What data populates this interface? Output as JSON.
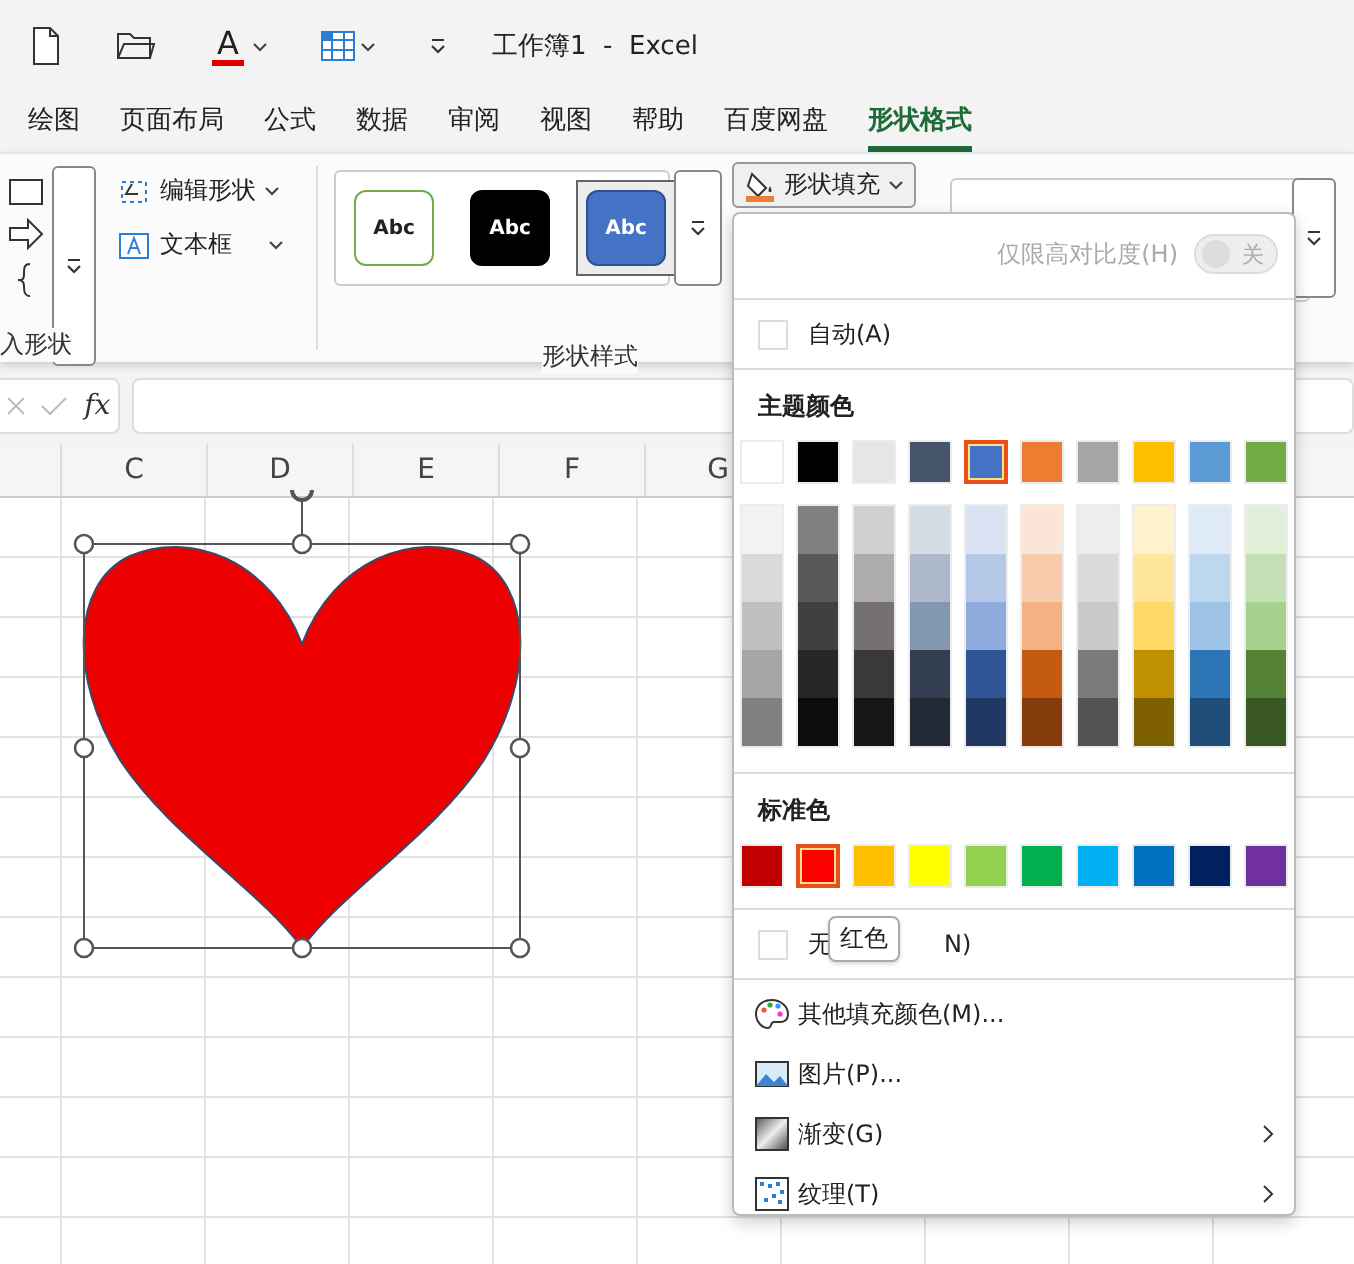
{
  "title_bar": {
    "font_color_glyph": "A",
    "title": "工作簿1  -  Excel"
  },
  "tabs": [
    {
      "label": "绘图",
      "selected": false
    },
    {
      "label": "页面布局",
      "selected": false
    },
    {
      "label": "公式",
      "selected": false
    },
    {
      "label": "数据",
      "selected": false
    },
    {
      "label": "审阅",
      "selected": false
    },
    {
      "label": "视图",
      "selected": false
    },
    {
      "label": "帮助",
      "selected": false
    },
    {
      "label": "百度网盘",
      "selected": false
    },
    {
      "label": "形状格式",
      "selected": true
    }
  ],
  "ribbon": {
    "insert_shapes_label": "入形状",
    "edit_shape": "编辑形状",
    "text_box": "文本框",
    "styles": [
      {
        "label": "Abc",
        "kind": "outline",
        "selected": false
      },
      {
        "label": "Abc",
        "kind": "dark",
        "selected": false
      },
      {
        "label": "Abc",
        "kind": "blue",
        "selected": true
      }
    ],
    "styles_label": "形状样式",
    "fill_button": "形状填充"
  },
  "formula_bar": {
    "fx": "fx"
  },
  "columns": [
    "C",
    "D",
    "E",
    "F",
    "G"
  ],
  "shape": {
    "selected": true
  },
  "fill_menu": {
    "high_contrast": {
      "label": "仅限高对比度(H)",
      "state_label": "关",
      "on": false
    },
    "auto": {
      "label": "自动(A)",
      "checked": false
    },
    "theme_title": "主题颜色",
    "theme_colors": [
      {
        "color": "#ffffff",
        "selected": false,
        "shades": [
          {
            "color": "#f2f2f2"
          },
          {
            "color": "#d9d9d9"
          },
          {
            "color": "#bfbfbf"
          },
          {
            "color": "#a6a6a6"
          },
          {
            "color": "#808080"
          }
        ]
      },
      {
        "color": "#000000",
        "selected": false,
        "shades": [
          {
            "color": "#808080"
          },
          {
            "color": "#595959"
          },
          {
            "color": "#404040"
          },
          {
            "color": "#262626"
          },
          {
            "color": "#0d0d0d"
          }
        ]
      },
      {
        "color": "#e7e6e6",
        "selected": false,
        "shades": [
          {
            "color": "#d0cece"
          },
          {
            "color": "#aeabab"
          },
          {
            "color": "#757171"
          },
          {
            "color": "#3a3838"
          },
          {
            "color": "#171616"
          }
        ]
      },
      {
        "color": "#44546a",
        "selected": false,
        "shades": [
          {
            "color": "#d6dce5"
          },
          {
            "color": "#adb9ca"
          },
          {
            "color": "#8497b0"
          },
          {
            "color": "#333f50"
          },
          {
            "color": "#222a35"
          }
        ]
      },
      {
        "color": "#4472c4",
        "selected": true,
        "shades": [
          {
            "color": "#dae3f3"
          },
          {
            "color": "#b4c7e7"
          },
          {
            "color": "#8faadc"
          },
          {
            "color": "#2f5597"
          },
          {
            "color": "#203864"
          }
        ]
      },
      {
        "color": "#ed7d31",
        "selected": false,
        "shades": [
          {
            "color": "#fbe5d6"
          },
          {
            "color": "#f8cbad"
          },
          {
            "color": "#f4b183"
          },
          {
            "color": "#c55a11"
          },
          {
            "color": "#843c0c"
          }
        ]
      },
      {
        "color": "#a5a5a5",
        "selected": false,
        "shades": [
          {
            "color": "#ededed"
          },
          {
            "color": "#dbdbdb"
          },
          {
            "color": "#c9c9c9"
          },
          {
            "color": "#7b7b7b"
          },
          {
            "color": "#525252"
          }
        ]
      },
      {
        "color": "#ffc000",
        "selected": false,
        "shades": [
          {
            "color": "#fff2cc"
          },
          {
            "color": "#ffe699"
          },
          {
            "color": "#ffd966"
          },
          {
            "color": "#bf9000"
          },
          {
            "color": "#7f6000"
          }
        ]
      },
      {
        "color": "#5b9bd5",
        "selected": false,
        "shades": [
          {
            "color": "#deebf7"
          },
          {
            "color": "#bdd7ee"
          },
          {
            "color": "#9dc3e6"
          },
          {
            "color": "#2e75b6"
          },
          {
            "color": "#1f4e79"
          }
        ]
      },
      {
        "color": "#70ad47",
        "selected": false,
        "shades": [
          {
            "color": "#e2f0d9"
          },
          {
            "color": "#c5e0b4"
          },
          {
            "color": "#a9d18e"
          },
          {
            "color": "#548235"
          },
          {
            "color": "#385723"
          }
        ]
      }
    ],
    "standard_title": "标准色",
    "standard_colors": [
      {
        "color": "#c00000",
        "selected": false
      },
      {
        "color": "#ff0000",
        "selected": true
      },
      {
        "color": "#ffc000",
        "selected": false
      },
      {
        "color": "#ffff00",
        "selected": false
      },
      {
        "color": "#92d050",
        "selected": false
      },
      {
        "color": "#00b050",
        "selected": false
      },
      {
        "color": "#00b0f0",
        "selected": false
      },
      {
        "color": "#0070c0",
        "selected": false
      },
      {
        "color": "#002060",
        "selected": false
      },
      {
        "color": "#7030a0",
        "selected": false
      }
    ],
    "no_fill": {
      "label_start": "无",
      "label_end": "N)",
      "checked": false
    },
    "tooltip": "红色",
    "items": [
      {
        "label": "其他填充颜色(M)...",
        "kind": "palette",
        "submenu": false
      },
      {
        "label": "图片(P)...",
        "kind": "picture",
        "submenu": false
      },
      {
        "label": "渐变(G)",
        "kind": "gradient",
        "submenu": true
      },
      {
        "label": "纹理(T)",
        "kind": "texture",
        "submenu": true
      }
    ]
  }
}
